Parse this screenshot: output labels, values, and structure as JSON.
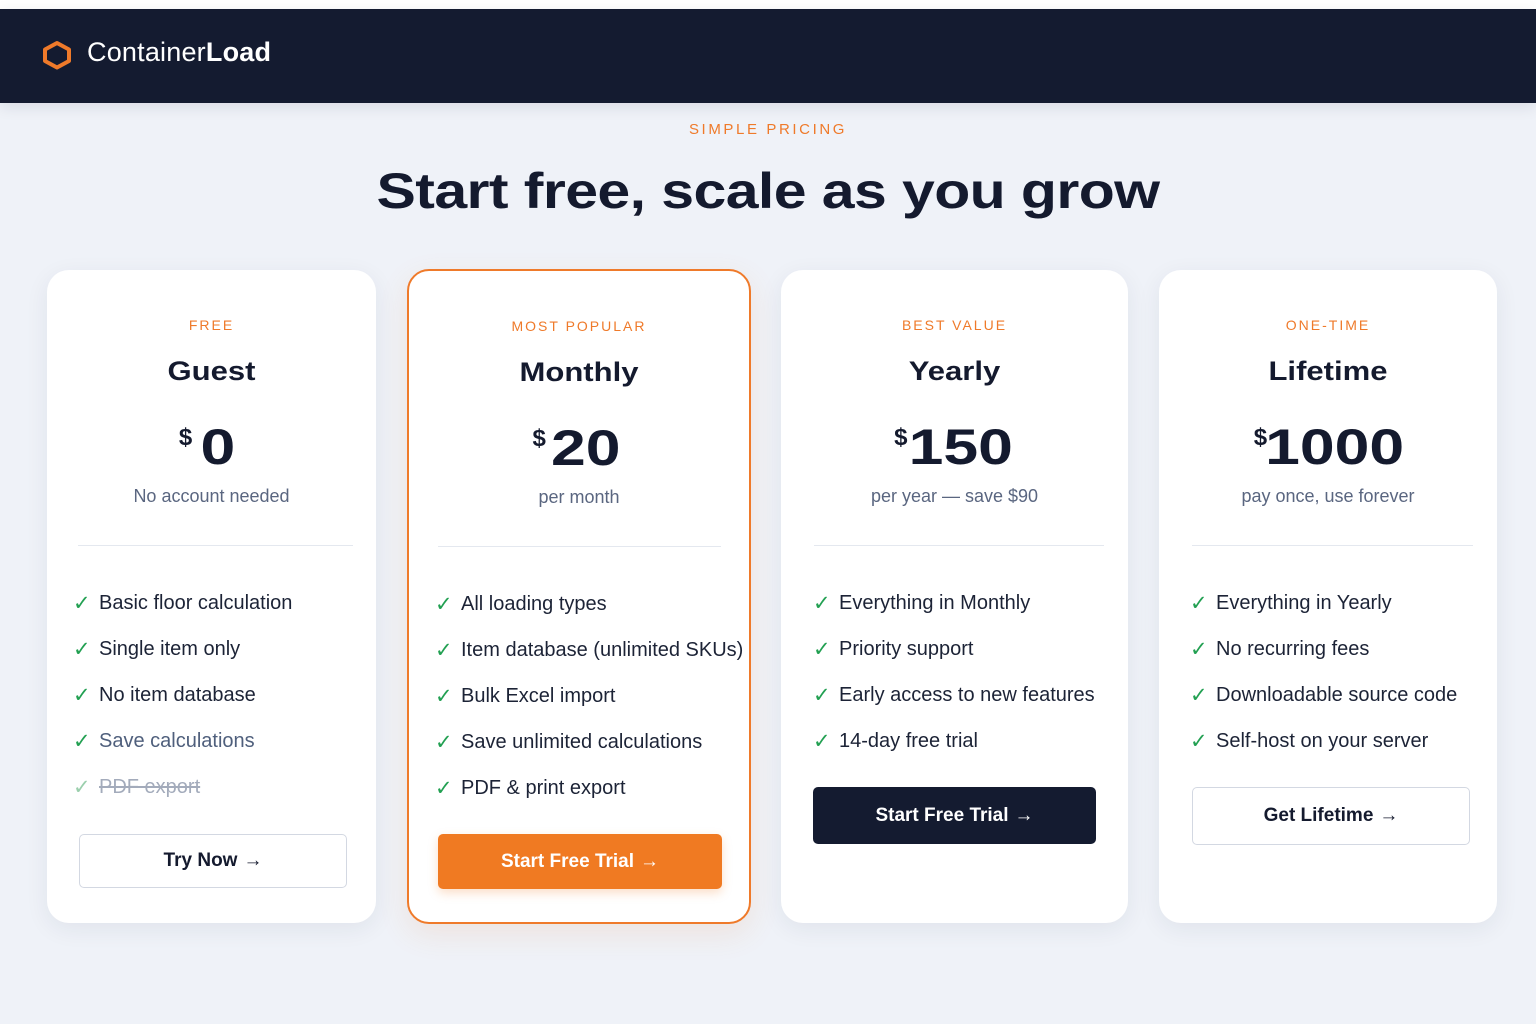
{
  "brand": {
    "name_regular": "Container",
    "name_bold": "Load",
    "accent_color": "#ef7a2a",
    "nav_bg": "#141b30",
    "logo_icon": "hexagon-icon"
  },
  "hero": {
    "eyebrow": "SIMPLE PRICING",
    "headline": "Start free, scale as you grow"
  },
  "plans": [
    {
      "tag": "FREE",
      "name": "Guest",
      "currency": "$",
      "price": "0",
      "note": "No account needed",
      "features": [
        "Basic floor calculation",
        "Single item only",
        "No item database",
        "Save calculations",
        "PDF export"
      ],
      "cta": "Try Now",
      "cta_arrow": "→"
    },
    {
      "tag": "MOST POPULAR",
      "name": "Monthly",
      "currency": "$",
      "price": "20",
      "note": "per month",
      "features": [
        "All loading types",
        "Item database (unlimited SKUs)",
        "Bulk Excel import",
        "Save unlimited calculations",
        "PDF & print export"
      ],
      "cta": "Start Free Trial",
      "cta_arrow": "→"
    },
    {
      "tag": "BEST VALUE",
      "name": "Yearly",
      "currency": "$",
      "price": "150",
      "note": "per year — save $90",
      "features": [
        "Everything in Monthly",
        "Priority support",
        "Early access to new features",
        "14-day free trial"
      ],
      "cta": "Start Free Trial",
      "cta_arrow": "→"
    },
    {
      "tag": "ONE-TIME",
      "name": "Lifetime",
      "currency": "$",
      "price": "1000",
      "note": "pay once, use forever",
      "features": [
        "Everything in Yearly",
        "No recurring fees",
        "Downloadable source code",
        "Self-host on your server"
      ],
      "cta": "Get Lifetime",
      "cta_arrow": "→"
    }
  ],
  "check_glyph": "✓",
  "icons": {
    "feature_check": "check-icon"
  }
}
